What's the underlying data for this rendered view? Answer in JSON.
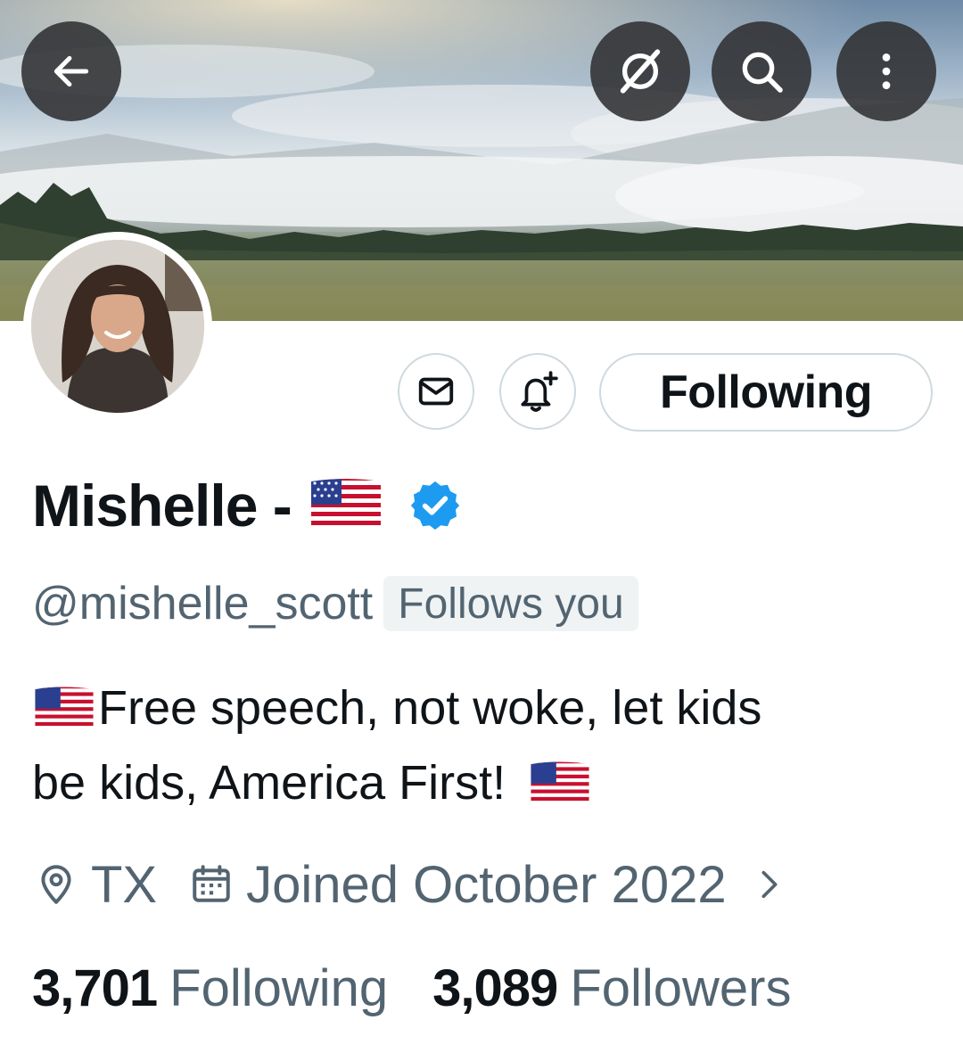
{
  "header": {
    "back_icon": "arrow-left-icon",
    "grok_icon": "grok-icon",
    "search_icon": "search-icon",
    "more_icon": "more-vertical-icon"
  },
  "profile": {
    "display_name": "Mishelle -",
    "name_emoji": "us-flag",
    "verified": true,
    "handle": "@mishelle_scott",
    "follows_you_badge": "Follows you",
    "bio_line1": "Free speech, not woke, let kids",
    "bio_line2": "be kids, America First!",
    "location": "TX",
    "joined": "Joined October 2022"
  },
  "actions": {
    "message_icon": "mail-icon",
    "notify_icon": "bell-plus-icon",
    "following_label": "Following"
  },
  "stats": {
    "following_count": "3,701",
    "following_label": "Following",
    "followers_count": "3,089",
    "followers_label": "Followers"
  },
  "colors": {
    "text_primary": "#0f1419",
    "text_secondary": "#536471",
    "verified_blue": "#1d9bf0",
    "button_border": "#cfd9de"
  }
}
